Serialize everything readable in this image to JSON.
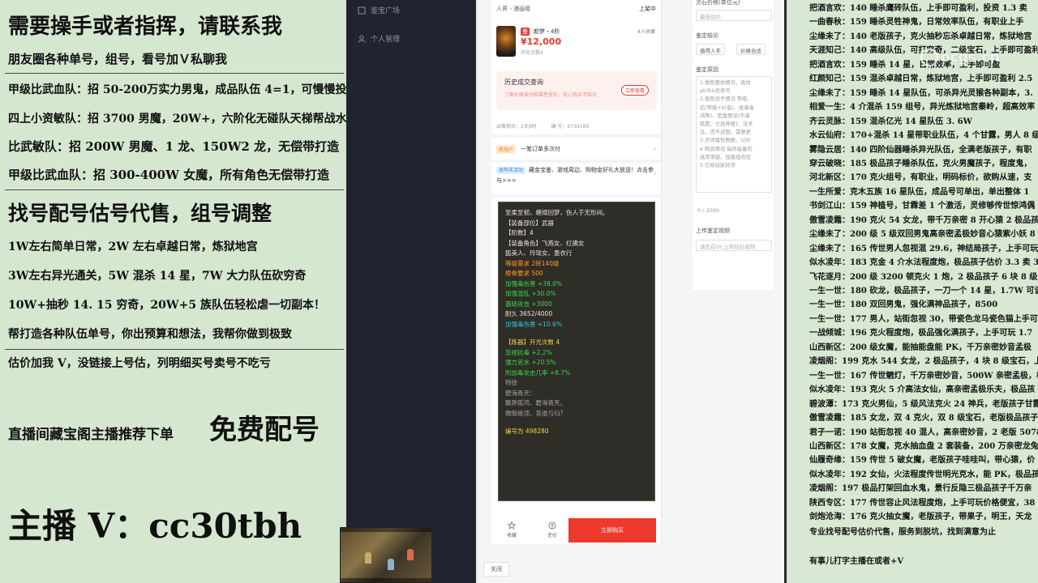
{
  "left_panel": {
    "lines": [
      "需要操手或者指挥，请联系我",
      "朋友圈各种单号，组号，看号加Ｖ私聊我",
      "甲级比武血队：招 50-200万实力男鬼，成品队伍 4=1，可慢慢投资",
      "四上小资敏队：招 3700 男魔，20W+，六阶化无碰队天梯帮战水陆 4 等 1",
      "比武敏队：招 200W 男魔、1 龙、150W2 龙，无偿带打造",
      "甲级比武血队：招 300-400W 女魔，所有角色无偿带打造",
      "找号配号估号代售，组号调整",
      "1W左右简单日常，2W 左右卓越日常，炼狱地宫",
      "3W左右异光通关，5W 混杀 14 星，7W 大力队伍砍穷奇",
      "10W+抽秒 14. 15 穷奇，20W+5 族队伍轻松虐一切副本！",
      "帮打造各种队伍单号，你出预算和想法，我帮你做到极致",
      "估价加我 V，没链接上号估，列明细买号卖号不吃亏",
      "直播间藏宝阁主播推荐下单",
      "免费配号",
      "主播 V：cc30tbh"
    ]
  },
  "dark_sidebar": {
    "items": [
      "鉴宝广场",
      "个人管理"
    ]
  },
  "phone": {
    "header_left": "人界 - 漫画嘤",
    "header_right": "上架中",
    "product": {
      "tag": "鉴",
      "name": "颜梦・4阶",
      "price": "¥12,000",
      "open_count": "开光次数4",
      "favorites": "4人收藏"
    },
    "history": {
      "title": "历史成交查询",
      "desc": "了解价格波动和属性变化，安心购买不踩坑",
      "button": "立即查看"
    },
    "meta": [
      "出售剩余：2天9时",
      "编 号：6739169"
    ],
    "promo1": {
      "tag": "新用户",
      "text": "一笔订单多次付"
    },
    "promo2": {
      "tag": "周年庆活动",
      "text": "藏金宝鉴、游戏周边、购物金好礼大放送！点击参与>>>"
    },
    "card": {
      "lines": [
        {
          "text": "至柔至韧，缠绵回梦，伤人于无形间。",
          "color": "c-white"
        },
        {
          "text": "【装备部位】武器",
          "color": "c-white"
        },
        {
          "text": "【阶数】4",
          "color": "c-white"
        },
        {
          "text": "【装备角色】飞燕女、红拂女",
          "color": "c-white"
        },
        {
          "text": "狐美人、玲珑女、墨衣行",
          "color": "c-white"
        },
        {
          "text": "等级需求 2转140级",
          "color": "c-orange"
        },
        {
          "text": "根骨要求 500",
          "color": "c-orange"
        },
        {
          "text": "加强毒伤害 +38.0%",
          "color": "c-green"
        },
        {
          "text": "加强混乱 +30.0%",
          "color": "c-green"
        },
        {
          "text": "基础攻击 +3000",
          "color": "c-green"
        },
        {
          "text": "耐久 3652/4000",
          "color": "c-white"
        },
        {
          "text": "加强毒伤害 +10.6%",
          "color": "c-cyan"
        },
        {
          "text": "",
          "color": "sp"
        },
        {
          "text": "【炼器】开光次数 4",
          "color": "c-yellow"
        },
        {
          "text": "忽视抗毒 +2.2%",
          "color": "c-green"
        },
        {
          "text": "强力克水 +20.5%",
          "color": "c-green"
        },
        {
          "text": "附加毒攻击几率 +8.7%",
          "color": "c-green"
        },
        {
          "text": "特技",
          "color": "c-gray"
        },
        {
          "text": "碧海青天：",
          "color": "c-gray"
        },
        {
          "text": "飘渺孤鸿、碧海青天。",
          "color": "c-gray"
        },
        {
          "text": "微瑕绝顶、吾谁与归？",
          "color": "c-gray"
        },
        {
          "text": "",
          "color": "sp"
        },
        {
          "text": "编号为 498280",
          "color": "c-yellow"
        }
      ]
    },
    "bottom": {
      "favorite": "收藏",
      "counter_offer": "还价",
      "buy": "立即购买"
    }
  },
  "form": {
    "top_input": "灵石价格(单位元)",
    "min_placeholder": "最低估价",
    "conclusion_label": "鉴定结论",
    "options": [
      "值得入手",
      "价格合适"
    ],
    "reason_label": "鉴定原因",
    "reason_lines": [
      "1.角色整体情况，具体",
      "pk号&任务号",
      "2.角色宠子情况 等级、",
      "石(等级+价值)、收录者",
      "鸿等)、是盘情况(不满",
      "练度、七段神兽)、法术",
      "法，否不适配，需要更",
      "3.点评属性数据，以炒",
      "4.物资情况 每件装备的",
      "高常项链、技能组合优",
      "5.引导玩家好评"
    ],
    "counter": "0 / 2000",
    "video_label": "上传鉴定视频",
    "video_placeholder": "请先在OC上传估价视频",
    "close": "关闭"
  },
  "right_panel": {
    "lines": [
      "把酒言欢：140 睡杀鹰砖队伍，上手即可盈利，投资 1.3 卖",
      "一曲春秋：159 睡杀灵牲神鬼，日常效率队伍，有职业上手",
      "尘缘未了：140 老版孩子，克火抽秒忘杀卓越日常，炼狱地宫",
      "天涯知己：140 高级队伍，可打穷奇，二级宝石，上手即可盈利，到",
      "把酒言欢：159 睡杀 14 星，日常效率，上手即可盈",
      "红颜知己：159 混杀卓越日常，炼狱地宫，上手即可盈利 2.5",
      "尘缘未了：159 睡杀 14 星队伍，可杀异光灵猴各种副本，3.",
      "相爱一生：4 介混杀 159 组号，异光炼狱地宫秦岭，超高效率",
      "齐云灵脉：159 混杀亿光 14 星队伍 3. 6W",
      "水云仙府：170+混杀 14 星带职业队伍，4 个甘露，男人 8 级",
      "雾隐云居：140 四阶仙器睡杀异光队伍，全满老版孩子，有职",
      "穿云破晓：185 极品孩子睡杀队伍，克火男魔孩子，程度鬼，",
      "河北新区：170 克火组号，有职业，明码标价，欲购从速，支",
      "一生所爱：克木五族 16 星队伍，成品号可单出，单出整体 1",
      "书剑江山：159 神植号，甘霖差 1 个激活，灵修够传世惊鸿偶",
      "傲雪凌霜：190 克火 54 女龙，带千万亲密 8 开心猿 2 极品孩子",
      "尘缘未了：200 级 5 级双回男鬼高亲密孟极妙音心猿紫小妖 8",
      "尘缘未了：165 传世男人忽视混 29.6，神结局孩子，上手可玩",
      "似水凌年：183 克金 4 介水法程度炮，极品孩子估价 3.3 卖 3",
      "飞花逐月：200 级 3200 顿克火 1 炮，2 极品孩子 6 块 8 级宝石",
      "一生一世：180 砍龙，极品孩子，一刀一个 14 星，1.7W 可谈",
      "一生一世：180 双回男鬼，强化满神品孩子，8500",
      "一生一世：177 男人，站街忽视 30，带瓷色龙马瓷色猫上手可",
      "一战倾城：196 克火程度炮，极品强化满孩子，上手可玩 1.7",
      "山西新区：200 级女魔，能抽能盘能 PK，千万亲密妙音孟极",
      "凌烟阁：199 克水 544 女龙，2 极品孩子，4 块 8 级宝石，上",
      "一生一世：167 传世魍灯，千万亲密妙音，500W 亲密孟极，极",
      "似水凌年：193 克火 5 介高法女仙，高亲密孟极乐夫，极品孩",
      "碧波潭：173 克火男仙，5 级风法克火 24 神兵，老版孩子甘露",
      "傲雪凌霜：185 女龙，双 4 克火，双 8 级宝石，老版极品孩子",
      "君子一诺：190 站街忽视 40 混人，高亲密妙音，2 老版 5078",
      "山西新区：178 女魔，克水抽血盘 2 套装备，200 万亲密龙兔",
      "仙履奇缘：159 传世 5 破女魔，老版孩子哇哇叫，带心猿，价",
      "似水凌年：192 女仙，火法程度传世明光克水，能 PK，极品孩",
      "凌烟阁：197 极品打架回血水鬼，景行反隐三极品孩子千万亲",
      "陕西专区：177 传世容止风法程度炮，上手可玩价格便宜，38",
      "剑炮沧海：176 克火抽女魔，老版孩子，带果子，明王，天龙",
      "专业找号配号估价代售，服务到脱坑，找到满意为止",
      "有事儿打字主播在或者+V"
    ]
  },
  "watermark": "ocgs.cn"
}
